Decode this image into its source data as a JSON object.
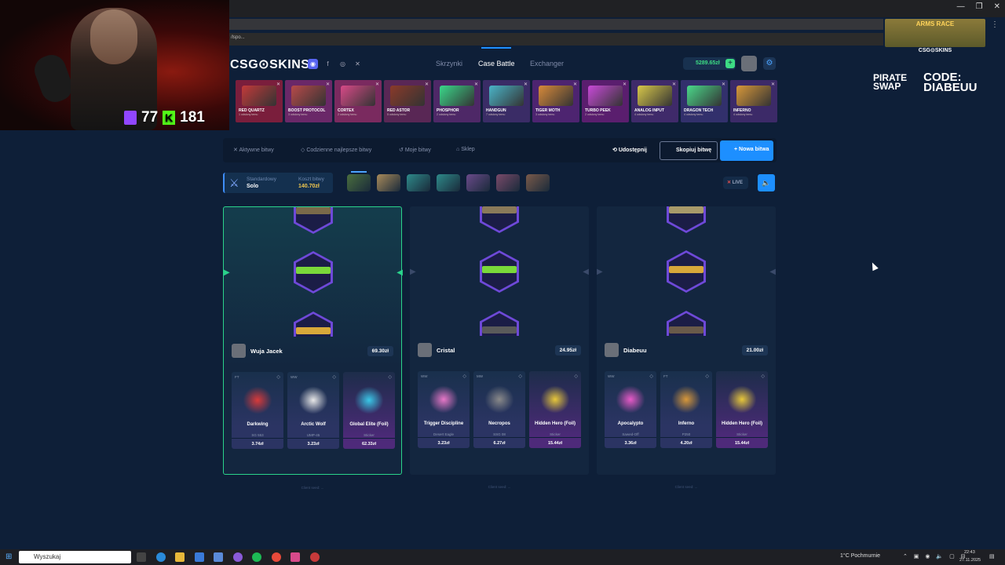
{
  "browser": {
    "url": "/lspo...",
    "controls": [
      "—",
      "❐",
      "✕"
    ]
  },
  "stream": {
    "twitch_count": "77",
    "kick_count": "181",
    "arms_race": "ARMS RACE",
    "arms_race_sub": "CSG⊙SKINS",
    "sponsor_1": "PIRATE SWAP",
    "sponsor_2": "CODE: DIABEUU"
  },
  "header": {
    "logo": "CSG⊙SKINS",
    "nav": [
      "Skrzynki",
      "Case Battle",
      "Exchanger"
    ],
    "active_nav": "Case Battle",
    "balance": "5289.65zł"
  },
  "cases": [
    {
      "name": "RED QUARTZ",
      "sub": "1 odsłony temu",
      "bg": "#7a1e3c",
      "art": "#c23a3a"
    },
    {
      "name": "BOOST PROTOCOL",
      "sub": "3 odsłony temu",
      "bg": "#6a2868",
      "art": "#b84a4a"
    },
    {
      "name": "CORTEX",
      "sub": "2 odsłony temu",
      "bg": "#7a2a5f",
      "art": "#d84a88"
    },
    {
      "name": "RED ASTOR",
      "sub": "5 odsłony temu",
      "bg": "#592755",
      "art": "#8a3a2a"
    },
    {
      "name": "PHOSPHOR",
      "sub": "2 odsłony temu",
      "bg": "#4e2867",
      "art": "#3ad88a"
    },
    {
      "name": "HANDGUN",
      "sub": "7 odsłony temu",
      "bg": "#3a2c66",
      "art": "#4ab4c8"
    },
    {
      "name": "TIGER MOTH",
      "sub": "3 odsłony temu",
      "bg": "#4d2470",
      "art": "#d88a3a"
    },
    {
      "name": "TURBO PEEK",
      "sub": "2 odsłony temu",
      "bg": "#5a1e6e",
      "art": "#c84ad8"
    },
    {
      "name": "ANALOG INPUT",
      "sub": "4 odsłony temu",
      "bg": "#3f2a6a",
      "art": "#d8c84a"
    },
    {
      "name": "DRAGON TECH",
      "sub": "4 odsłony temu",
      "bg": "#32306c",
      "art": "#4ad88a"
    },
    {
      "name": "INFERNO",
      "sub": "4 odsłony temu",
      "bg": "#3c2a68",
      "art": "#d8983a"
    }
  ],
  "toolbar": {
    "tabs": [
      "Aktywne bitwy",
      "Codzienne najlepsze bitwy",
      "Moje bitwy",
      "Sklep"
    ],
    "share": "Udostępnij",
    "copy": "Skopiuj bitwę",
    "new_battle": "+ Nowa bitwa"
  },
  "battle": {
    "mode_label": "Standardowy",
    "mode_value": "Solo",
    "cost_label": "Koszt bitwy",
    "cost_value": "140.70zł",
    "live": "LIVE",
    "round_cases": [
      "#4a6e3e",
      "#a88a5a",
      "#2e8a8a",
      "#2e8a8a",
      "#6a4a8a",
      "#7a4a6a",
      "#7a5a4a"
    ]
  },
  "players": [
    {
      "name": "Wuja Jacek",
      "total": "69.30zł",
      "seed": "Client seed: ...",
      "skins": [
        {
          "wear": "FT",
          "name": "Darkwing",
          "sub": "SG 553",
          "price": "3.74zł",
          "art": "#d83a3a",
          "style": "blue"
        },
        {
          "wear": "WW",
          "name": "Arctic Wolf",
          "sub": "UMP-45",
          "price": "3.23zł",
          "art": "#e8e8e8",
          "style": "blue"
        },
        {
          "wear": "",
          "name": "Global Elite (Foil)",
          "sub": "Sticker",
          "price": "62.33zł",
          "art": "#3ac8e8",
          "style": "gold"
        }
      ]
    },
    {
      "name": "Cristal",
      "total": "24.95zł",
      "seed": "Client seed: ...",
      "skins": [
        {
          "wear": "WW",
          "name": "Trigger Discipline",
          "sub": "Desert Eagle",
          "price": "3.23zł",
          "art": "#e878c8",
          "style": "blue"
        },
        {
          "wear": "MW",
          "name": "Necropos",
          "sub": "SSG 08",
          "price": "6.27zł",
          "art": "#8a8a8a",
          "style": "blue"
        },
        {
          "wear": "",
          "name": "Hidden Hero (Foil)",
          "sub": "Sticker",
          "price": "15.44zł",
          "art": "#e8c83a",
          "style": "gold"
        }
      ]
    },
    {
      "name": "Diabeuu",
      "total": "21.00zł",
      "seed": "Client seed: ...",
      "skins": [
        {
          "wear": "WW",
          "name": "Apocalypto",
          "sub": "Sawed-Off",
          "price": "3.36zł",
          "art": "#e85ac8",
          "style": "blue"
        },
        {
          "wear": "FT",
          "name": "Inferno",
          "sub": "P250",
          "price": "4.20zł",
          "art": "#d8983a",
          "style": "blue"
        },
        {
          "wear": "",
          "name": "Hidden Hero (Foil)",
          "sub": "Sticker",
          "price": "15.44zł",
          "art": "#e8c83a",
          "style": "gold"
        }
      ]
    }
  ],
  "taskbar": {
    "search": "Wyszukaj",
    "weather": "1°C  Pochmurnie",
    "time": "22:43",
    "date": "27.11.2025"
  }
}
